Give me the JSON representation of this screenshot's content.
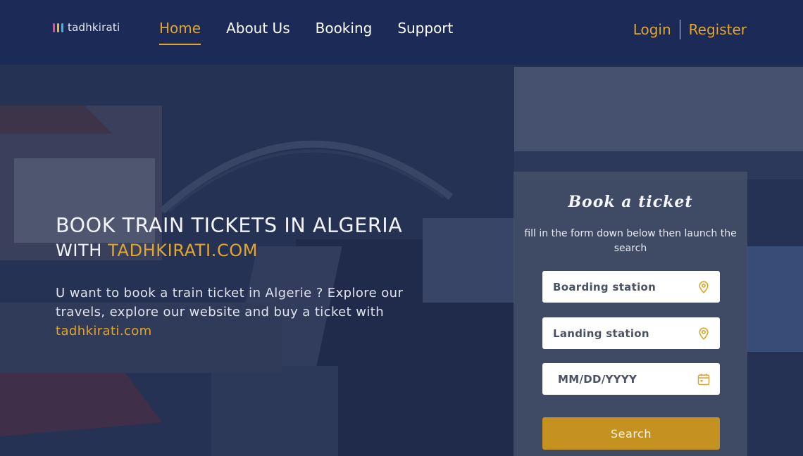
{
  "brand": {
    "name": "tadhkirati",
    "bar_colors": [
      "#e84b8a",
      "#f2b632",
      "#3db6e8"
    ]
  },
  "nav": {
    "items": [
      {
        "label": "Home",
        "active": true
      },
      {
        "label": "About Us",
        "active": false
      },
      {
        "label": "Booking",
        "active": false
      },
      {
        "label": "Support",
        "active": false
      }
    ],
    "login": "Login",
    "register": "Register"
  },
  "hero": {
    "title": "BOOK TRAIN TICKETS IN ALGERIA",
    "subtitle_prefix": "WITH ",
    "subtitle_accent": "TADHKIRATI.COM",
    "description": "U want to book a train ticket in Algerie ? Explore our travels, explore our website and buy a ticket with ",
    "description_accent": "tadhkirati.com"
  },
  "booking": {
    "title": "Book a ticket",
    "subtitle": "fill in the form down below then launch the search",
    "boarding_placeholder": "Boarding station",
    "landing_placeholder": "Landing station",
    "date_placeholder": "MM/DD/YYYY",
    "search_label": "Search",
    "icons": [
      "location-pin-icon",
      "location-pin-icon",
      "calendar-icon"
    ]
  },
  "colors": {
    "accent": "#e1a62b",
    "navbar": "#1b2a57",
    "button": "#c59121"
  }
}
